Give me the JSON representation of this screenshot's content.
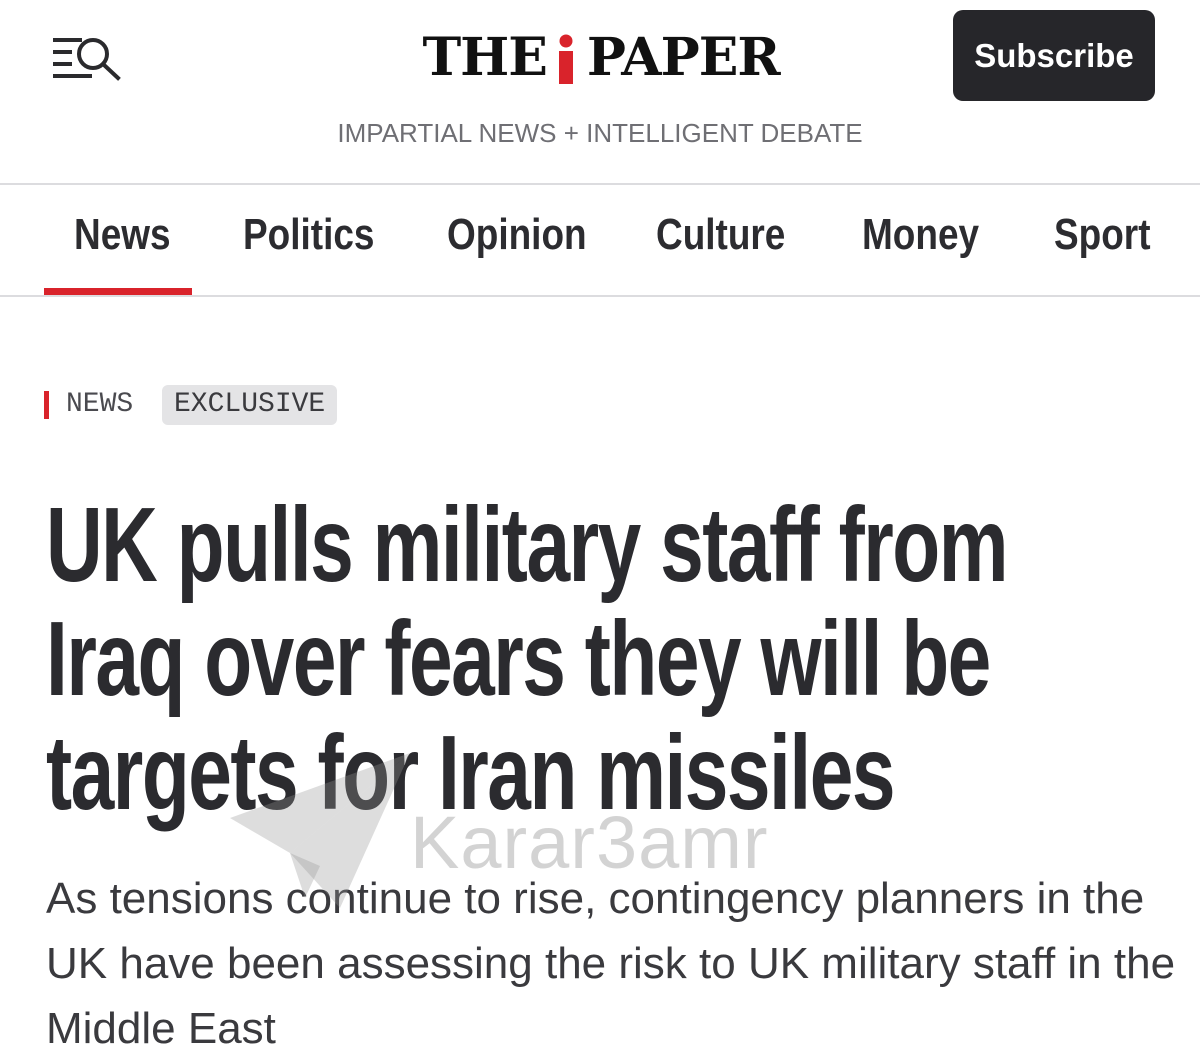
{
  "header": {
    "menu_icon": "menu-search-icon",
    "logo": {
      "left": "THE",
      "right": "PAPER",
      "mark": "i",
      "mark_color": "#d9232b"
    },
    "tagline": "IMPARTIAL NEWS + INTELLIGENT DEBATE",
    "subscribe_label": "Subscribe"
  },
  "nav": {
    "items": [
      {
        "label": "News",
        "active": true
      },
      {
        "label": "Politics",
        "active": false
      },
      {
        "label": "Opinion",
        "active": false
      },
      {
        "label": "Culture",
        "active": false
      },
      {
        "label": "Money",
        "active": false
      },
      {
        "label": "Sport",
        "active": false
      }
    ],
    "accent_color": "#d9232b"
  },
  "article": {
    "section_tag": "NEWS",
    "label_tag": "EXCLUSIVE",
    "headline_lines": [
      "UK pulls military staff from",
      "Iraq over fears they will be",
      "targets for Iran missiles"
    ],
    "standfirst": "As tensions continue to rise, contingency planners in the UK have been assessing the risk to UK military staff in the Middle East"
  },
  "watermark": {
    "text": "Karar3amr",
    "icon": "paper-plane-icon"
  },
  "colors": {
    "brand_red": "#d9232b",
    "button_dark": "#26262a",
    "text_dark": "#2b2b2f"
  }
}
